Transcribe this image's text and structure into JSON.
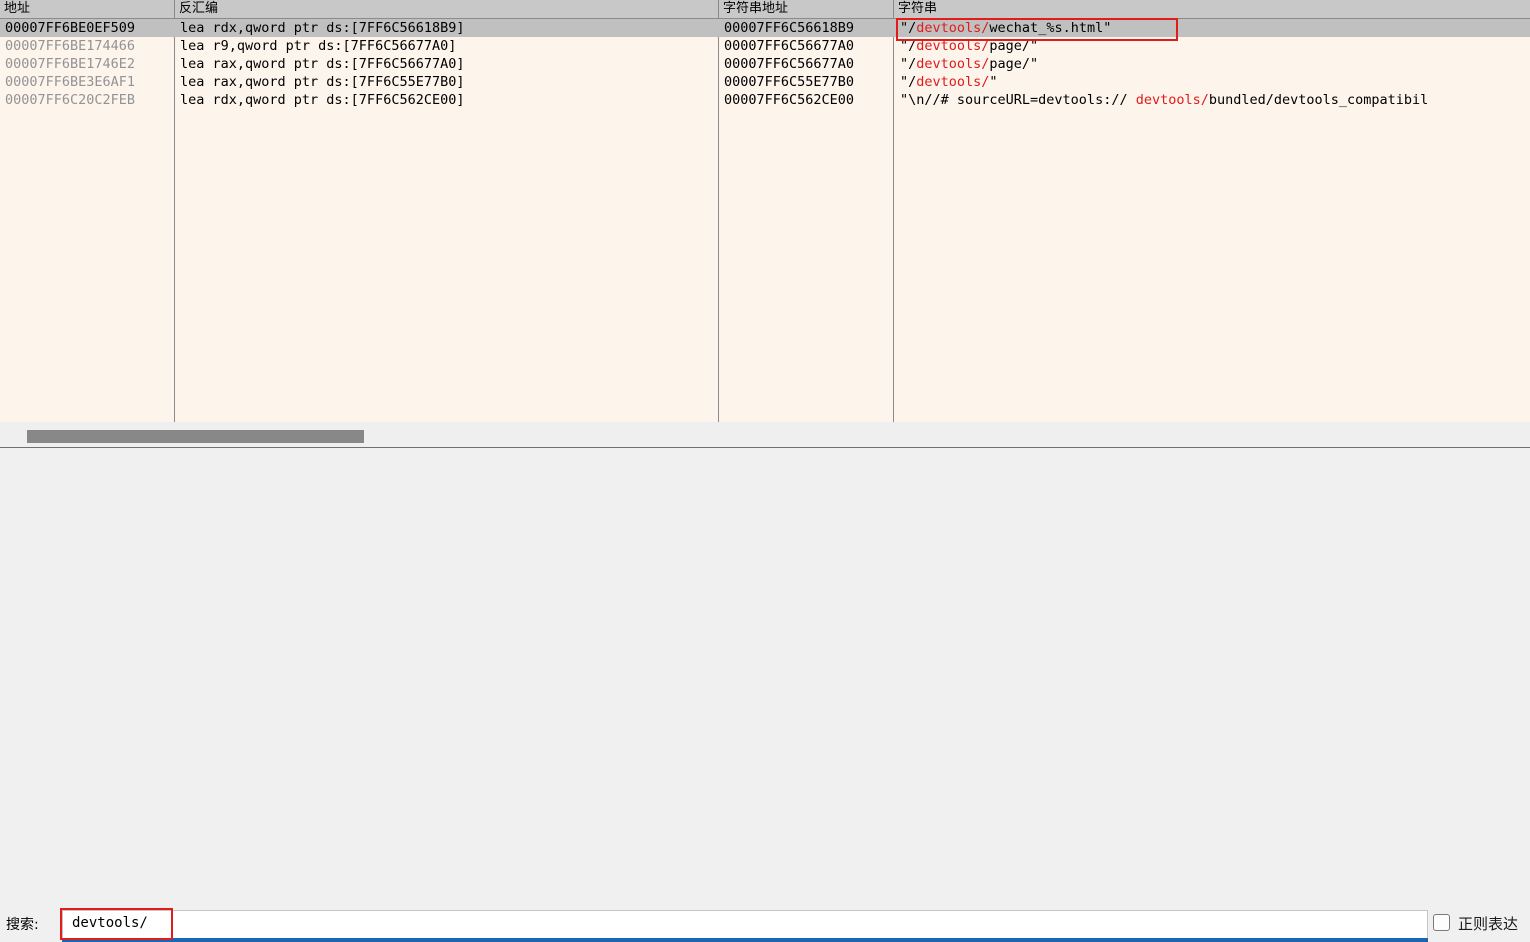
{
  "columns": [
    {
      "id": "address",
      "label": "地址"
    },
    {
      "id": "disassembly",
      "label": "反汇编"
    },
    {
      "id": "string_address",
      "label": "字符串地址"
    },
    {
      "id": "string",
      "label": "字符串"
    }
  ],
  "rows": [
    {
      "address": "00007FF6BE0EF509",
      "disassembly": "lea rdx,qword ptr ds:[7FF6C56618B9]",
      "string_address": "00007FF6C56618B9",
      "string": "\"/devtools/wechat_%s.html\"",
      "string_parts": [
        {
          "t": "\"/",
          "m": false
        },
        {
          "t": "devtools/",
          "m": true
        },
        {
          "t": "wechat_%s.html\"",
          "m": false
        }
      ],
      "selected": true
    },
    {
      "address": "00007FF6BE174466",
      "disassembly": "lea r9,qword ptr ds:[7FF6C56677A0]",
      "string_address": "00007FF6C56677A0",
      "string": "\"/devtools/page/\"",
      "string_parts": [
        {
          "t": "\"/",
          "m": false
        },
        {
          "t": "devtools/",
          "m": true
        },
        {
          "t": "page/\"",
          "m": false
        }
      ],
      "selected": false
    },
    {
      "address": "00007FF6BE1746E2",
      "disassembly": "lea rax,qword ptr ds:[7FF6C56677A0]",
      "string_address": "00007FF6C56677A0",
      "string": "\"/devtools/page/\"",
      "string_parts": [
        {
          "t": "\"/",
          "m": false
        },
        {
          "t": "devtools/",
          "m": true
        },
        {
          "t": "page/\"",
          "m": false
        }
      ],
      "selected": false
    },
    {
      "address": "00007FF6BE3E6AF1",
      "disassembly": "lea rax,qword ptr ds:[7FF6C55E77B0]",
      "string_address": "00007FF6C55E77B0",
      "string": "\"/devtools/\"",
      "string_parts": [
        {
          "t": "\"/",
          "m": false
        },
        {
          "t": "devtools/",
          "m": true
        },
        {
          "t": "\"",
          "m": false
        }
      ],
      "selected": false
    },
    {
      "address": "00007FF6C20C2FEB",
      "disassembly": "lea rdx,qword ptr ds:[7FF6C562CE00]",
      "string_address": "00007FF6C562CE00",
      "string": "\"\\n//# sourceURL=devtools:// devtools/bundled/devtools_compatibil",
      "string_parts": [
        {
          "t": "\"\\n//# sourceURL=devtools:// ",
          "m": false
        },
        {
          "t": "devtools/",
          "m": true
        },
        {
          "t": "bundled/devtools_compatibil",
          "m": false
        }
      ],
      "selected": false
    }
  ],
  "scrollbar": {
    "orientation": "horizontal"
  },
  "search": {
    "label": "搜索:",
    "value": "devtools/",
    "placeholder": ""
  },
  "regex": {
    "label": "正则表达",
    "checked": false
  },
  "colors": {
    "match_highlight": "#e01b1b",
    "annotation": "#e21b1b",
    "list_background": "#fdf4ec",
    "header_background": "#c8c8c8",
    "selected_row": "#c0c0c0",
    "focus_underline": "#1866b5",
    "dim_address": "#939393"
  }
}
